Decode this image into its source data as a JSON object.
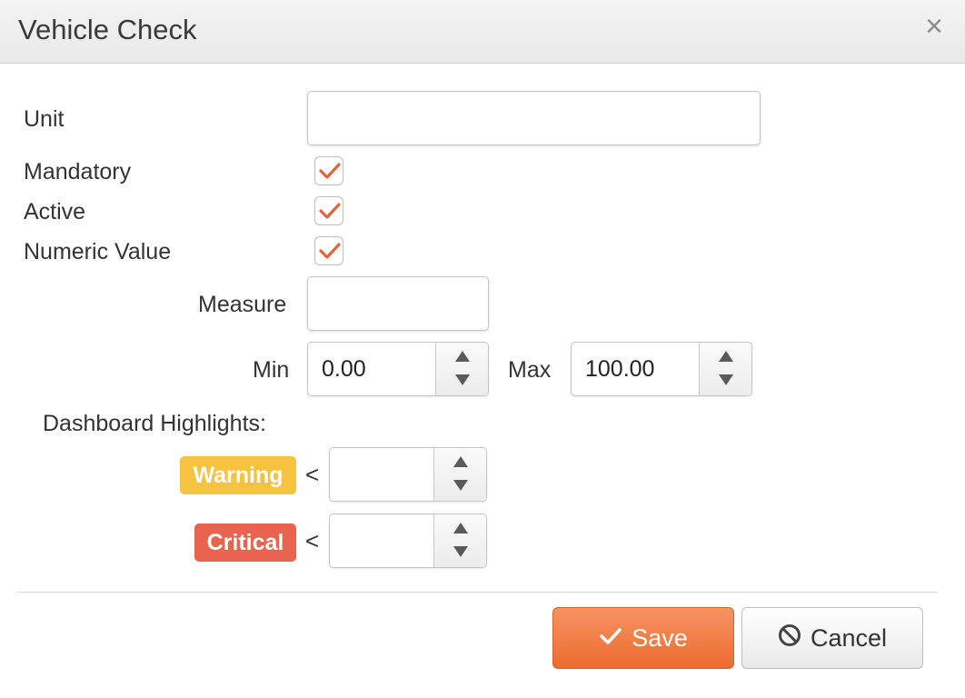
{
  "dialog": {
    "title": "Vehicle Check",
    "close_icon": "close-icon",
    "close_glyph": "×"
  },
  "form": {
    "unit": {
      "label": "Unit",
      "value": "",
      "placeholder": ""
    },
    "mandatory": {
      "label": "Mandatory",
      "checked": true
    },
    "active": {
      "label": "Active",
      "checked": true
    },
    "numeric_value": {
      "label": "Numeric Value",
      "checked": true
    },
    "measure": {
      "label": "Measure",
      "value": ""
    },
    "min": {
      "label": "Min",
      "value": "0.00"
    },
    "max": {
      "label": "Max",
      "value": "100.00"
    },
    "dashboard_highlights": {
      "label": "Dashboard Highlights:",
      "warning": {
        "badge": "Warning",
        "operator": "<",
        "value": ""
      },
      "critical": {
        "badge": "Critical",
        "operator": "<",
        "value": ""
      }
    }
  },
  "buttons": {
    "save": {
      "label": "Save",
      "icon": "check-icon"
    },
    "cancel": {
      "label": "Cancel",
      "icon": "ban-icon"
    }
  },
  "colors": {
    "accent": "#ec6b2f",
    "checkmark": "#e0663a",
    "warning": "#f5c340",
    "critical": "#e8644f"
  }
}
